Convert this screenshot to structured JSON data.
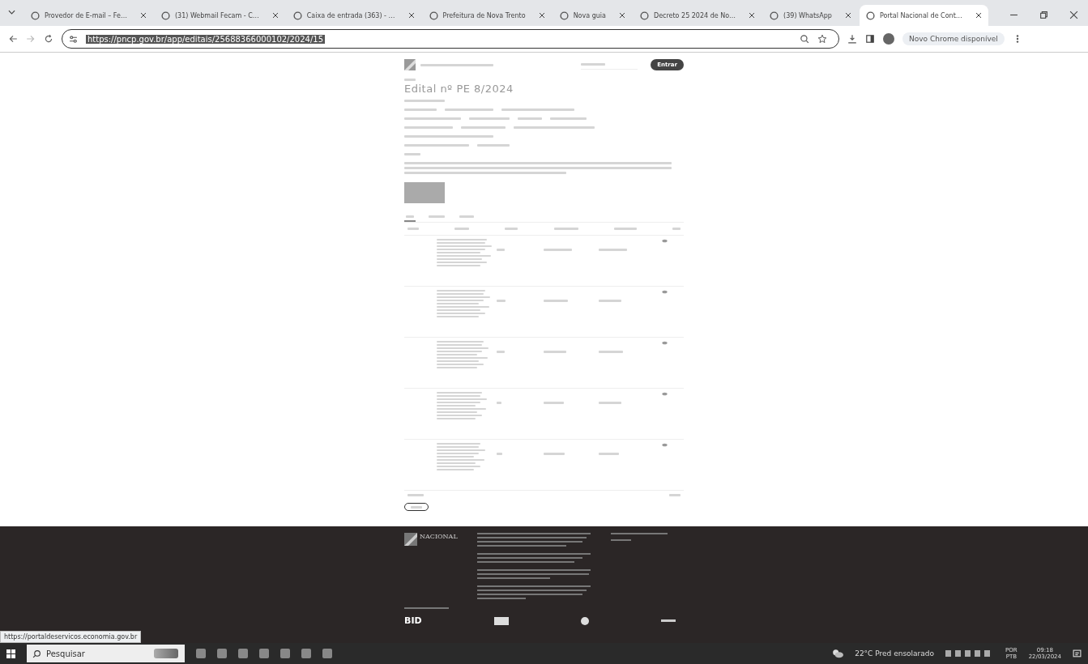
{
  "browser": {
    "tabs": [
      {
        "title": "Provedor de E-mail – Fe…",
        "selected": false
      },
      {
        "title": "(31) Webmail Fecam - C…",
        "selected": false
      },
      {
        "title": "Caixa de entrada (363) - …",
        "selected": false
      },
      {
        "title": "Prefeitura de Nova Trento",
        "selected": false
      },
      {
        "title": "Nova guia",
        "selected": false
      },
      {
        "title": "Decreto 25 2024 de No…",
        "selected": false
      },
      {
        "title": "(39) WhatsApp",
        "selected": false
      },
      {
        "title": "Portal Nacional de Cont…",
        "selected": true
      }
    ],
    "url": "https://pncp.gov.br/app/editais/25688366000102/2024/15",
    "update_notice": "Novo Chrome disponível"
  },
  "page": {
    "title": "Edital nº PE 8/2024",
    "section_tabs": [
      {
        "selected": true
      },
      {
        "selected": false
      },
      {
        "selected": false
      }
    ],
    "login_button": "Entrar",
    "footer": {
      "logo_text": "NACIONAL",
      "sponsor": "BID"
    }
  },
  "status_url": "https://portaldeservicos.economia.gov.br",
  "taskbar": {
    "search_placeholder": "Pesquisar",
    "weather": "22°C Pred ensolarado",
    "language": "POR",
    "layout": "PTB",
    "time": "09:18",
    "date": "22/03/2024"
  }
}
